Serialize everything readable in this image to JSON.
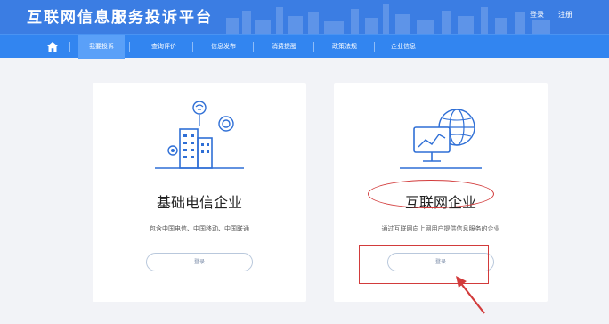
{
  "header": {
    "site_title": "互联网信息服务投诉平台",
    "login": "登录",
    "register": "注册"
  },
  "nav": {
    "home_icon": "home-icon",
    "items": [
      {
        "label": "我要投诉",
        "active": true
      },
      {
        "label": "查询评价",
        "active": false
      },
      {
        "label": "信息发布",
        "active": false
      },
      {
        "label": "消费提醒",
        "active": false
      },
      {
        "label": "政策法规",
        "active": false
      },
      {
        "label": "企业信息",
        "active": false
      }
    ]
  },
  "cards": [
    {
      "title": "基础电信企业",
      "description": "包含中国电信、中国移动、中国联通",
      "button": "登录",
      "icon": "telecom-buildings-icon"
    },
    {
      "title": "互联网企业",
      "description": "通过互联网向上网用户提供信息服务的企业",
      "button": "登录",
      "icon": "monitor-globe-icon"
    }
  ],
  "colors": {
    "header_bg": "#3b7de3",
    "nav_bg": "#3285f0",
    "nav_active": "#5aa0f8",
    "annotation": "#d23b3b",
    "page_bg": "#f2f3f7"
  }
}
